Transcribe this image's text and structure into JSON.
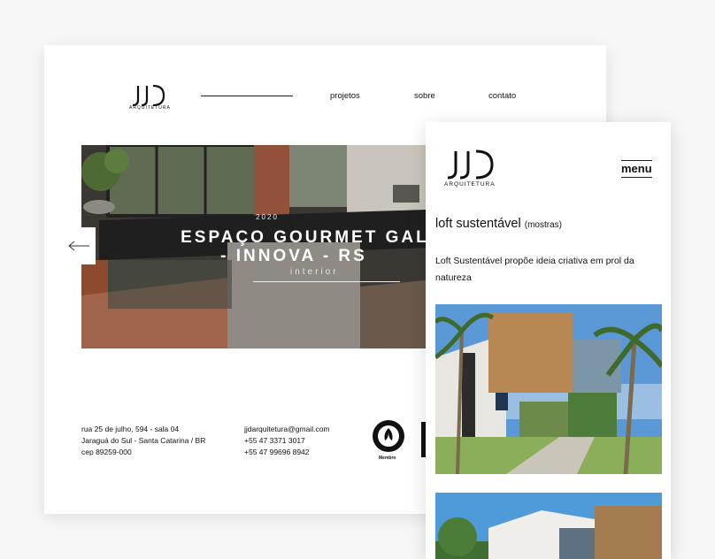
{
  "desktop": {
    "logo": {
      "mark": "JJD",
      "subtitle": "ARQUITETURA"
    },
    "nav": [
      "projetos",
      "sobre",
      "contato"
    ],
    "hero": {
      "year": "2020",
      "title_line1": "ESPAÇO GOURMET GALPÃO C",
      "title_line2": "- INNOVA - RS",
      "subtitle": "interior"
    },
    "footer": {
      "address": [
        "rua 25 de julho, 594 - sala 04",
        "Jaraguá do Sul - Santa Catarina / BR",
        "cep 89259-000"
      ],
      "contact": [
        "jjdarquitetura@gmail.com",
        "+55 47 3371 3017",
        "+55 47 99696 8942"
      ],
      "badge_label": "Membro"
    }
  },
  "mobile": {
    "logo": {
      "mark": "JJD",
      "subtitle": "ARQUITETURA"
    },
    "menu_label": "menu",
    "project_title": "loft sustentável",
    "project_tag": "(mostras)",
    "project_description": "Loft Sustentável propõe ideia criativa em prol da natureza"
  },
  "icons": [
    "arrow-left-icon",
    "green-building-council-seal-icon"
  ]
}
